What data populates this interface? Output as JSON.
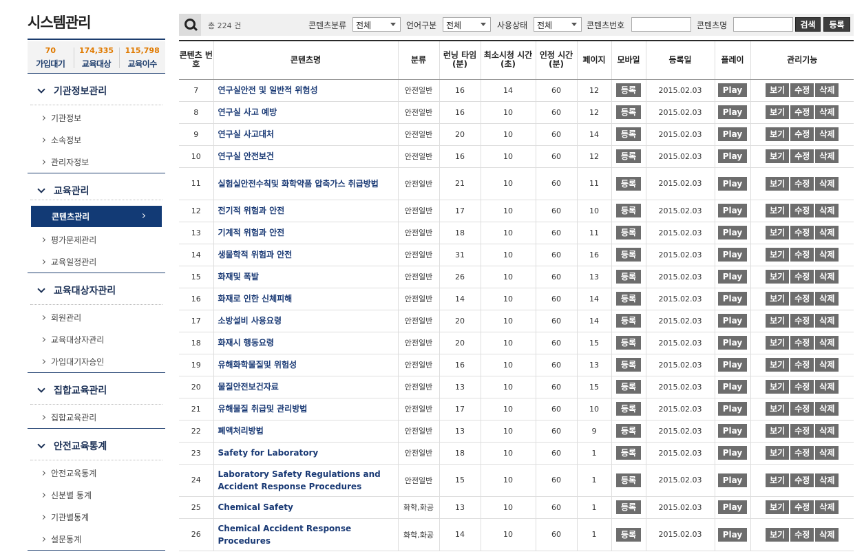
{
  "sidebar": {
    "title": "시스템관리",
    "stats": [
      {
        "value": "70",
        "label": "가입대기"
      },
      {
        "value": "174,335",
        "label": "교육대상"
      },
      {
        "value": "115,798",
        "label": "교육이수"
      }
    ],
    "sections": [
      {
        "title": "기관정보관리",
        "items": [
          "기관정보",
          "소속정보",
          "관리자정보"
        ]
      },
      {
        "title": "교육관리",
        "items": [
          "콘텐츠관리",
          "평가문제관리",
          "교육일정관리"
        ],
        "active_index": 0
      },
      {
        "title": "교육대상자관리",
        "items": [
          "회원관리",
          "교육대상자관리",
          "가입대기자승인"
        ]
      },
      {
        "title": "집합교육관리",
        "items": [
          "집합교육관리"
        ]
      },
      {
        "title": "안전교육통계",
        "items": [
          "안전교육통계",
          "신분별 통계",
          "기관별통계",
          "설문통계"
        ]
      }
    ]
  },
  "search": {
    "total": "총 224 건",
    "category_label": "콘텐츠분류",
    "category_value": "전체",
    "language_label": "언어구분",
    "language_value": "전체",
    "status_label": "사용상태",
    "status_value": "전체",
    "number_label": "콘텐츠번호",
    "number_value": "",
    "name_label": "콘텐츠명",
    "name_value": "",
    "search_button": "검색",
    "register_button": "등록"
  },
  "table": {
    "headers": [
      "콘텐츠 번호",
      "콘텐츠명",
      "분류",
      "런닝 타임 (분)",
      "최소시청 시간(초)",
      "인정 시간 (분)",
      "페이지",
      "모바일",
      "등록일",
      "플레이",
      "관리기능"
    ],
    "mobile_label": "등록",
    "play_label": "Play",
    "view_label": "보기",
    "edit_label": "수정",
    "delete_label": "삭제",
    "rows": [
      {
        "no": "7",
        "name": "연구실안전 및 일반적 위험성",
        "cat": "안전일반",
        "run": "16",
        "min": "14",
        "cred": "60",
        "page": "12",
        "date": "2015.02.03"
      },
      {
        "no": "8",
        "name": "연구실 사고 예방",
        "cat": "안전일반",
        "run": "16",
        "min": "10",
        "cred": "60",
        "page": "12",
        "date": "2015.02.03"
      },
      {
        "no": "9",
        "name": "연구실 사고대처",
        "cat": "안전일반",
        "run": "20",
        "min": "10",
        "cred": "60",
        "page": "14",
        "date": "2015.02.03"
      },
      {
        "no": "10",
        "name": "연구실 안전보건",
        "cat": "안전일반",
        "run": "16",
        "min": "10",
        "cred": "60",
        "page": "12",
        "date": "2015.02.03"
      },
      {
        "no": "11",
        "name": "실험실안전수칙및 화학약품 압축가스 취급방법",
        "cat": "안전일반",
        "run": "21",
        "min": "10",
        "cred": "60",
        "page": "11",
        "date": "2015.02.03",
        "tall": true
      },
      {
        "no": "12",
        "name": "전기적 위험과 안전",
        "cat": "안전일반",
        "run": "17",
        "min": "10",
        "cred": "60",
        "page": "10",
        "date": "2015.02.03"
      },
      {
        "no": "13",
        "name": "기계적 위험과 안전",
        "cat": "안전일반",
        "run": "18",
        "min": "10",
        "cred": "60",
        "page": "11",
        "date": "2015.02.03"
      },
      {
        "no": "14",
        "name": "생물학적 위험과 안전",
        "cat": "안전일반",
        "run": "31",
        "min": "10",
        "cred": "60",
        "page": "16",
        "date": "2015.02.03"
      },
      {
        "no": "15",
        "name": "화재및 폭발",
        "cat": "안전일반",
        "run": "26",
        "min": "10",
        "cred": "60",
        "page": "13",
        "date": "2015.02.03"
      },
      {
        "no": "16",
        "name": "화재로 인한 신체피해",
        "cat": "안전일반",
        "run": "14",
        "min": "10",
        "cred": "60",
        "page": "14",
        "date": "2015.02.03"
      },
      {
        "no": "17",
        "name": "소방설비 사용요령",
        "cat": "안전일반",
        "run": "20",
        "min": "10",
        "cred": "60",
        "page": "14",
        "date": "2015.02.03"
      },
      {
        "no": "18",
        "name": "화재시 행동요령",
        "cat": "안전일반",
        "run": "20",
        "min": "10",
        "cred": "60",
        "page": "15",
        "date": "2015.02.03"
      },
      {
        "no": "19",
        "name": "유해화학물질및 위험성",
        "cat": "안전일반",
        "run": "16",
        "min": "10",
        "cred": "60",
        "page": "13",
        "date": "2015.02.03"
      },
      {
        "no": "20",
        "name": "물질안전보건자료",
        "cat": "안전일반",
        "run": "13",
        "min": "10",
        "cred": "60",
        "page": "15",
        "date": "2015.02.03"
      },
      {
        "no": "21",
        "name": "유해물질 취급및 관리방법",
        "cat": "안전일반",
        "run": "17",
        "min": "10",
        "cred": "60",
        "page": "10",
        "date": "2015.02.03"
      },
      {
        "no": "22",
        "name": "폐액처리방법",
        "cat": "안전일반",
        "run": "13",
        "min": "10",
        "cred": "60",
        "page": "9",
        "date": "2015.02.03"
      },
      {
        "no": "23",
        "name": "Safety for Laboratory",
        "cat": "안전일반",
        "run": "18",
        "min": "10",
        "cred": "60",
        "page": "1",
        "date": "2015.02.03"
      },
      {
        "no": "24",
        "name": "Laboratory Safety Regulations and Accident Response Procedures",
        "cat": "안전일반",
        "run": "15",
        "min": "10",
        "cred": "60",
        "page": "1",
        "date": "2015.02.03",
        "tall": true
      },
      {
        "no": "25",
        "name": "Chemical Safety",
        "cat": "화학,화공",
        "run": "13",
        "min": "10",
        "cred": "60",
        "page": "1",
        "date": "2015.02.03"
      },
      {
        "no": "26",
        "name": "Chemical Accident Response Procedures",
        "cat": "화학,화공",
        "run": "14",
        "min": "10",
        "cred": "60",
        "page": "1",
        "date": "2015.02.03",
        "tall": true
      }
    ]
  }
}
